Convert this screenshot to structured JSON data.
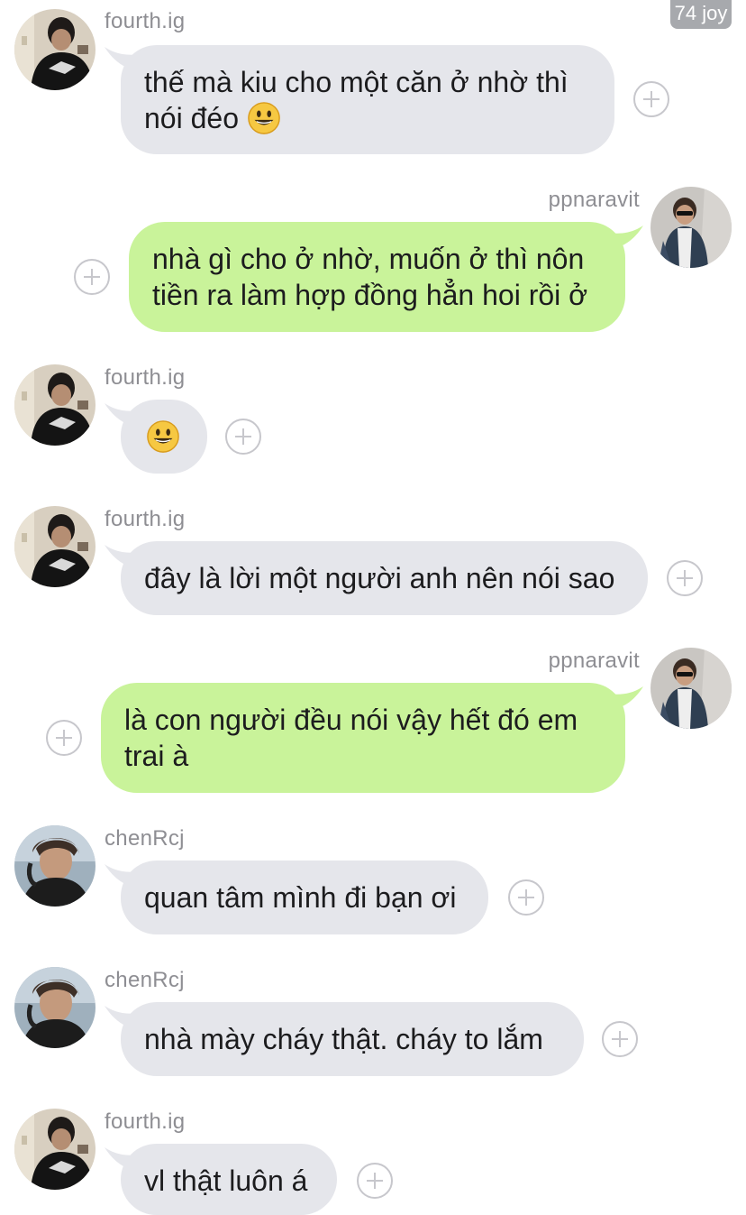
{
  "badge": "74 joy",
  "colors": {
    "bubble_gray": "#e5e6eb",
    "bubble_green": "#c9f39a",
    "sender_text": "#8e8e93",
    "plus_icon": "#c7c7cc"
  },
  "messages": [
    {
      "sender": "fourth.ig",
      "text": "thế mà kiu cho một căn ở nhờ thì\nnói đéo",
      "emoji": "grinning-face-emoji",
      "side": "left"
    },
    {
      "sender": "ppnaravit",
      "text": "nhà gì cho ở nhờ, muốn ở thì nôn\ntiền ra làm hợp đồng hẳn hoi rồi ở",
      "side": "right"
    },
    {
      "sender": "fourth.ig",
      "text": "",
      "emoji": "grinning-face-emoji",
      "side": "left"
    },
    {
      "sender": "fourth.ig",
      "text": "đây là lời một người anh nên nói sao",
      "side": "left"
    },
    {
      "sender": "ppnaravit",
      "text": "là con người đều nói vậy hết đó em\ntrai à",
      "side": "right"
    },
    {
      "sender": "chenRcj",
      "text": "quan tâm mình đi bạn ơi",
      "side": "left"
    },
    {
      "sender": "chenRcj",
      "text": "nhà mày cháy thật. cháy to lắm",
      "side": "left"
    },
    {
      "sender": "fourth.ig",
      "text": "vl thật luôn á",
      "side": "left"
    }
  ]
}
